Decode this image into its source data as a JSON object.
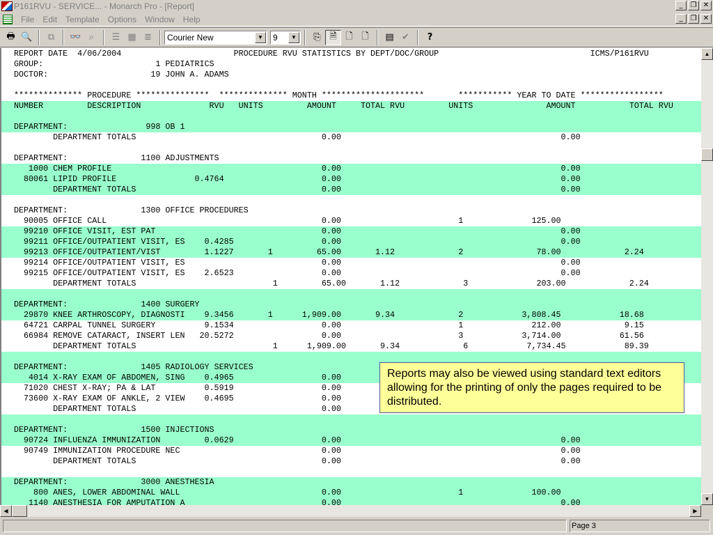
{
  "window": {
    "title": "P161RVU -  SERVICE... - Monarch Pro - [Report]"
  },
  "menu": [
    "File",
    "Edit",
    "Template",
    "Options",
    "Window",
    "Help"
  ],
  "toolbar": {
    "font_name": "Courier New",
    "font_size": "9"
  },
  "report": {
    "lines": [
      "REPORT DATE  4/06/2004                       PROCEDURE RVU STATISTICS BY DEPT/DOC/GROUP                               ICMS/P161RVU",
      "GROUP:                       1 PEDIATRICS",
      "DOCTOR:                     19 JOHN A. ADAMS",
      "",
      "************** PROCEDURE ***************  ************** MONTH *********************       *********** YEAR TO DATE *****************",
      "NUMBER         DESCRIPTION              RVU   UNITS         AMOUNT     TOTAL RVU         UNITS               AMOUNT           TOTAL RVU",
      "",
      "DEPARTMENT:                998 OB 1",
      "        DEPARTMENT TOTALS                                      0.00                                             0.00",
      "",
      "DEPARTMENT:               1100 ADJUSTMENTS",
      "   1000 CHEM PROFILE                                           0.00                                             0.00",
      "  80061 LIPID PROFILE                0.4764                    0.00                                             0.00",
      "        DEPARTMENT TOTALS                                      0.00                                             0.00",
      "",
      "DEPARTMENT:               1300 OFFICE PROCEDURES",
      "  90005 OFFICE CALL                                            0.00                        1              125.00",
      "  99210 OFFICE VISIT, EST PAT                                  0.00                                             0.00",
      "  99211 OFFICE/OUTPATIENT VISIT, ES    0.4285                  0.00                                             0.00",
      "  99213 OFFICE/OUTPATIENT/VIST         1.1227       1         65.00       1.12             2               78.00             2.24",
      "  99214 OFFICE/OUTPATIENT VISIT, ES                            0.00                                             0.00",
      "  99215 OFFICE/OUTPATIENT VISIT, ES    2.6523                  0.00                                             0.00",
      "        DEPARTMENT TOTALS                            1         65.00       1.12             3              203.00             2.24",
      "",
      "DEPARTMENT:               1400 SURGERY",
      "  29870 KNEE ARTHROSCOPY, DIAGNOSTI    9.3456       1      1,909.00       9.34             2            3,808.45            18.68",
      "  64721 CARPAL TUNNEL SURGERY          9.1534                  0.00                        1              212.00             9.15",
      "  66984 REMOVE CATARACT, INSERT LEN   20.5272                  0.00                        3            3,714.00            61.56",
      "        DEPARTMENT TOTALS                            1      1,909.00       9.34             6            7,734.45            89.39",
      "",
      "DEPARTMENT:               1405 RADIOLOGY SERVICES",
      "   4014 X-RAY EXAM OF ABDOMEN, SING    0.4965                  0.00",
      "  71020 CHEST X-RAY; PA & LAT          0.5919                  0.00",
      "  73600 X-RAY EXAM OF ANKLE, 2 VIEW    0.4695                  0.00",
      "        DEPARTMENT TOTALS                                      0.00",
      "",
      "DEPARTMENT:               1500 INJECTIONS",
      "  90724 INFLUENZA IMMUNIZATION         0.0629                  0.00                                             0.00",
      "  90749 IMMUNIZATION PROCEDURE NEC                             0.00                                             0.00",
      "        DEPARTMENT TOTALS                                      0.00                                             0.00",
      "",
      "DEPARTMENT:               3000 ANESTHESIA",
      "    800 ANES, LOWER ABDOMINAL WALL                             0.00                        1              100.00",
      "   1140 ANESTHESIA FOR AMPUTATION A                            0.00                                             0.00"
    ]
  },
  "callout": {
    "text": "Reports may also be viewed using standard text editors allowing for the printing of only the pages required to be distributed."
  },
  "status": {
    "page": "Page 3"
  },
  "colors": {
    "band": "#99ffcc",
    "callout_bg": "#ffff99"
  }
}
